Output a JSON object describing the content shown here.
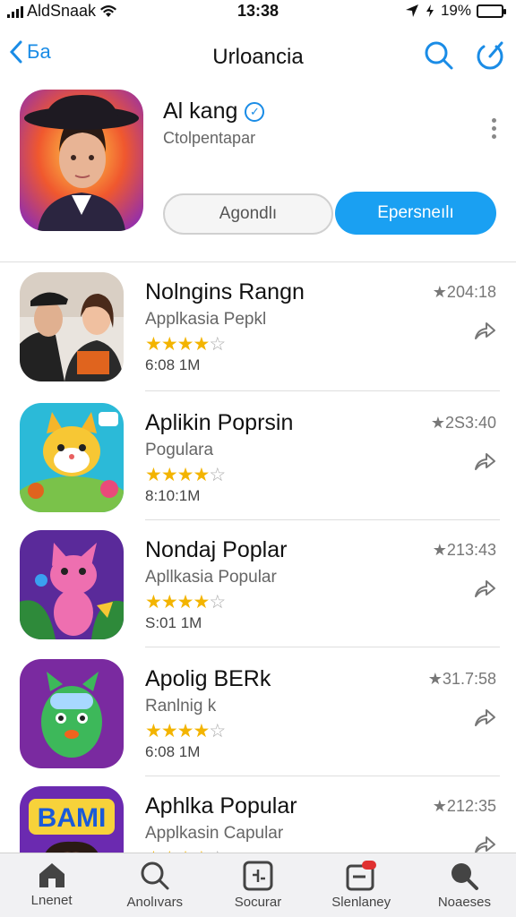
{
  "status_bar": {
    "carrier": "AldSnaak",
    "time": "13:38",
    "battery": "19%"
  },
  "nav": {
    "back_label": "Ба",
    "title": "Urloancia"
  },
  "featured": {
    "name": "Al kang",
    "developer": "Ctolpentapar",
    "button_secondary": "Agondlı",
    "button_primary": "Epersneılı"
  },
  "apps": [
    {
      "title": "Nolngins Rangn",
      "subtitle": "Applkasia Pepkl",
      "size": "6:08 1M",
      "rating": "★204:18",
      "stars": 4
    },
    {
      "title": "Aplikin Poprsin",
      "subtitle": "Pogulara",
      "size": "8:10:1M",
      "rating": "★2S3:40",
      "stars": 4
    },
    {
      "title": "Nondaj Poplar",
      "subtitle": "Apllkasia Popular",
      "size": "S:01 1M",
      "rating": "★213:43",
      "stars": 4
    },
    {
      "title": "Apolig BERk",
      "subtitle": "Ranlnig k",
      "size": "6:08 1M",
      "rating": "★31.7:58",
      "stars": 4
    },
    {
      "title": "Aphlka Popular",
      "subtitle": "Applkasin Capular",
      "size": "",
      "rating": "★212:35",
      "stars": 4
    }
  ],
  "icon_art": {
    "banner_text": "BAMI"
  },
  "tabs": [
    {
      "label": "Lnenet",
      "icon": "home-icon"
    },
    {
      "label": "Anolıvars",
      "icon": "search-icon"
    },
    {
      "label": "Socurar",
      "icon": "apps-icon"
    },
    {
      "label": "Slenlaney",
      "icon": "updates-icon"
    },
    {
      "label": "Noaeses",
      "icon": "search-icon"
    }
  ],
  "colors": {
    "accent": "#1a8ce6",
    "primary_button": "#1aa0f2",
    "star": "#f3b400"
  }
}
